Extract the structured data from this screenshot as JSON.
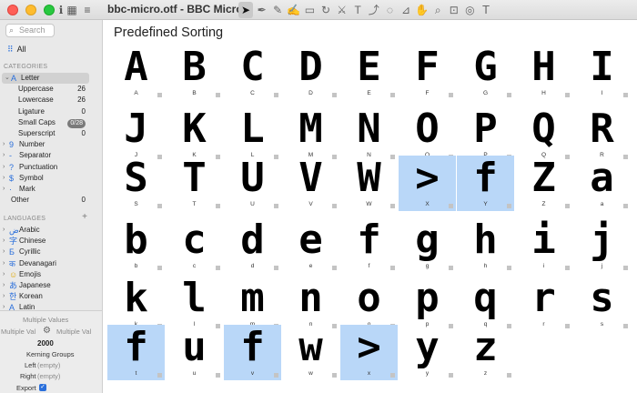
{
  "window": {
    "title": "bbc-micro.otf - BBC Micro"
  },
  "toolbar": {
    "icons": [
      "info-icon",
      "grid-view-icon",
      "list-view-icon"
    ],
    "tools": [
      {
        "name": "select-tool",
        "glyph": "➤",
        "active": true
      },
      {
        "name": "pen-tool",
        "glyph": "✒"
      },
      {
        "name": "pencil-tool",
        "glyph": "✎"
      },
      {
        "name": "brush-tool",
        "glyph": "✍"
      },
      {
        "name": "rectangle-tool",
        "glyph": "▭"
      },
      {
        "name": "rotate-tool",
        "glyph": "↻"
      },
      {
        "name": "knife-tool",
        "glyph": "⚔"
      },
      {
        "name": "text-tool",
        "glyph": "T"
      },
      {
        "name": "path-tool",
        "glyph": "⤴"
      },
      {
        "name": "annotation-tool",
        "glyph": "◌"
      },
      {
        "name": "measure-tool",
        "glyph": "⊿"
      },
      {
        "name": "hand-tool",
        "glyph": "✋"
      },
      {
        "name": "zoom-tool",
        "glyph": "⌕"
      },
      {
        "name": "camera-tool",
        "glyph": "⊡"
      },
      {
        "name": "spiral-tool",
        "glyph": "◎"
      },
      {
        "name": "type-tool",
        "glyph": "ꓔ"
      }
    ]
  },
  "sidebar": {
    "search_placeholder": "Search",
    "all_label": "All",
    "categories_header": "CATEGORIES",
    "categories": [
      {
        "label": "Letter",
        "icon": "A",
        "count": "",
        "expanded": true,
        "selected": true
      },
      {
        "label": "Uppercase",
        "count": "26",
        "sub": true
      },
      {
        "label": "Lowercase",
        "count": "26",
        "sub": true
      },
      {
        "label": "Ligature",
        "count": "0",
        "sub": true
      },
      {
        "label": "Small Caps",
        "count": "0/28",
        "sub": true,
        "badge": true
      },
      {
        "label": "Superscript",
        "count": "0",
        "sub": true
      },
      {
        "label": "Number",
        "icon": "9",
        "count": ""
      },
      {
        "label": "Separator",
        "icon": "‐",
        "count": ""
      },
      {
        "label": "Punctuation",
        "icon": "?",
        "count": ""
      },
      {
        "label": "Symbol",
        "icon": "$",
        "count": ""
      },
      {
        "label": "Mark",
        "icon": "·",
        "count": ""
      },
      {
        "label": "Other",
        "icon": "",
        "count": "0"
      }
    ],
    "languages_header": "LANGUAGES",
    "languages": [
      {
        "label": "Arabic",
        "icon": "ض"
      },
      {
        "label": "Chinese",
        "icon": "字"
      },
      {
        "label": "Cyrillic",
        "icon": "Б"
      },
      {
        "label": "Devanagari",
        "icon": "क"
      },
      {
        "label": "Emojis",
        "icon": "☺"
      },
      {
        "label": "Japanese",
        "icon": "あ"
      },
      {
        "label": "Korean",
        "icon": "한"
      },
      {
        "label": "Latin",
        "icon": "A"
      }
    ]
  },
  "inspector": {
    "multiple_values": "Multiple Values",
    "left_multi": "Multiple Val",
    "right_multi": "Multiple Val",
    "width_value": "2000",
    "kerning_groups": "Kerning Groups",
    "left_label": "Left",
    "left_value": "(empty)",
    "right_label": "Right",
    "right_value": "(empty)",
    "export_label": "Export"
  },
  "main": {
    "heading": "Predefined Sorting",
    "glyphs": [
      {
        "char": "A",
        "name": "A"
      },
      {
        "char": "B",
        "name": "B"
      },
      {
        "char": "C",
        "name": "C"
      },
      {
        "char": "D",
        "name": "D"
      },
      {
        "char": "E",
        "name": "E"
      },
      {
        "char": "F",
        "name": "F"
      },
      {
        "char": "G",
        "name": "G"
      },
      {
        "char": "H",
        "name": "H"
      },
      {
        "char": "I",
        "name": "I"
      },
      {
        "char": "J",
        "name": "J"
      },
      {
        "char": "K",
        "name": "K"
      },
      {
        "char": "L",
        "name": "L"
      },
      {
        "char": "M",
        "name": "M"
      },
      {
        "char": "N",
        "name": "N"
      },
      {
        "char": "O",
        "name": "O"
      },
      {
        "char": "P",
        "name": "P"
      },
      {
        "char": "Q",
        "name": "Q"
      },
      {
        "char": "R",
        "name": "R"
      },
      {
        "char": "S",
        "name": "S"
      },
      {
        "char": "T",
        "name": "T"
      },
      {
        "char": "U",
        "name": "U"
      },
      {
        "char": "V",
        "name": "V"
      },
      {
        "char": "W",
        "name": "W"
      },
      {
        "char": ">",
        "name": "X",
        "selected": true
      },
      {
        "char": "f",
        "name": "Y",
        "selected": true
      },
      {
        "char": "Z",
        "name": "Z"
      },
      {
        "char": "a",
        "name": "a"
      },
      {
        "char": "b",
        "name": "b"
      },
      {
        "char": "c",
        "name": "c"
      },
      {
        "char": "d",
        "name": "d"
      },
      {
        "char": "e",
        "name": "e"
      },
      {
        "char": "f",
        "name": "f"
      },
      {
        "char": "g",
        "name": "g"
      },
      {
        "char": "h",
        "name": "h"
      },
      {
        "char": "i",
        "name": "i"
      },
      {
        "char": "j",
        "name": "j"
      },
      {
        "char": "k",
        "name": "k"
      },
      {
        "char": "l",
        "name": "l"
      },
      {
        "char": "m",
        "name": "m"
      },
      {
        "char": "n",
        "name": "n"
      },
      {
        "char": "o",
        "name": "o"
      },
      {
        "char": "p",
        "name": "p"
      },
      {
        "char": "q",
        "name": "q"
      },
      {
        "char": "r",
        "name": "r"
      },
      {
        "char": "s",
        "name": "s"
      },
      {
        "char": "f",
        "name": "t",
        "selected": true
      },
      {
        "char": "u",
        "name": "u"
      },
      {
        "char": "f",
        "name": "v",
        "selected": true
      },
      {
        "char": "w",
        "name": "w"
      },
      {
        "char": ">",
        "name": "x",
        "selected": true
      },
      {
        "char": "y",
        "name": "y"
      },
      {
        "char": "z",
        "name": "z"
      }
    ]
  },
  "colors": {
    "accent": "#2a6fdb",
    "selection": "#b9d7f8",
    "sidebar_bg": "#e9e9e9"
  }
}
